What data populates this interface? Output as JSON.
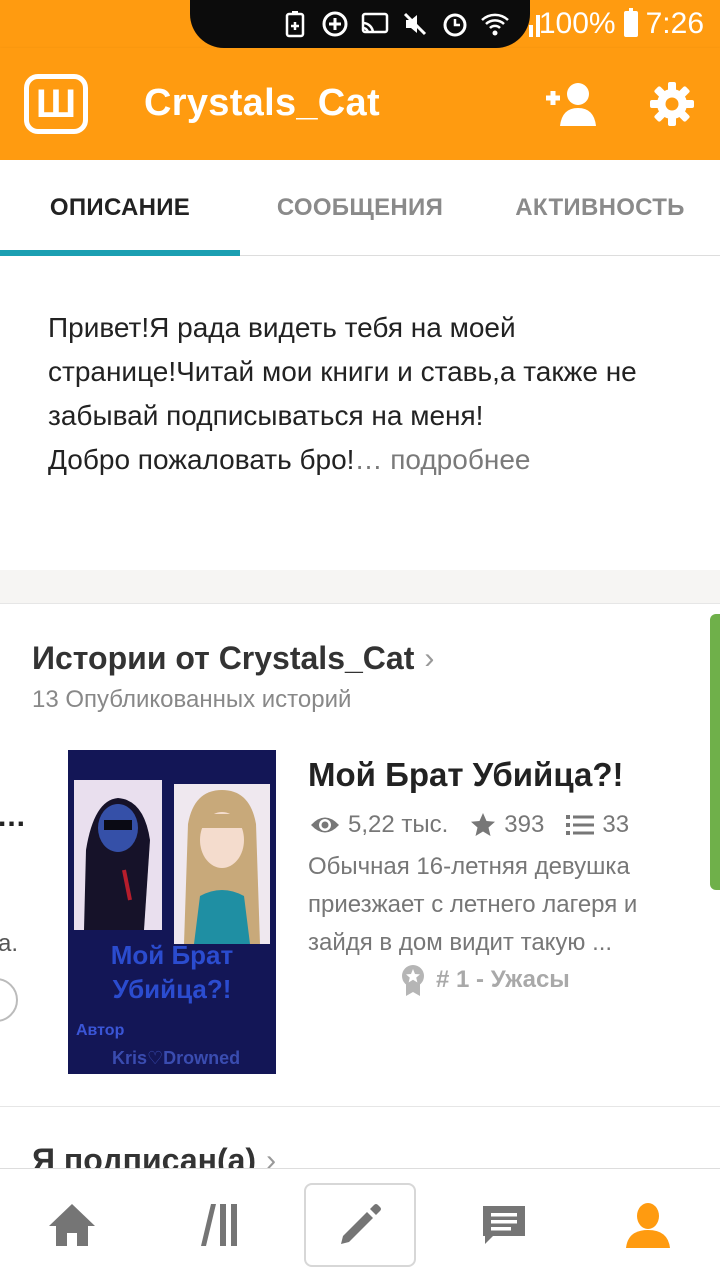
{
  "status_bar": {
    "battery": "100%",
    "time": "7:26",
    "icons": [
      "battery-saver-icon",
      "data-saver-icon",
      "cast-icon",
      "mute-icon",
      "alarm-icon",
      "wifi-icon",
      "signal-icon",
      "battery-icon"
    ]
  },
  "app_bar": {
    "logo": "Ш",
    "title": "Crystals_Cat",
    "actions": [
      "add-follower-icon",
      "settings-icon"
    ],
    "color": "#ff9b10"
  },
  "tabs": [
    {
      "label": "ОПИСАНИЕ",
      "active": true
    },
    {
      "label": "СООБЩЕНИЯ",
      "active": false
    },
    {
      "label": "АКТИВНОСТЬ",
      "active": false
    }
  ],
  "accent_color": "#1b9fb2",
  "description": {
    "text": "Привет!Я рада видеть тебя на моей странице!Читай мои книги и ставь,а также не забывай подписываться на меня!",
    "text2": "Добро пожаловать бро!",
    "ellipsis": "…",
    "more": " подробнее"
  },
  "stories": {
    "title": "Истории от Crystals_Cat",
    "count_label": "13 Опубликованных историй",
    "prev_peek_dots": "...",
    "prev_peek_letter": "а.",
    "story": {
      "title": "Мой Брат Убийца?!",
      "views": "5,22 тыс.",
      "votes": "393",
      "parts": "33",
      "description": "Обычная 16-летняя девушка приезжает с летнего лагеря и зайдя в дом видит такую ...",
      "rank": "# 1 - Ужасы",
      "cover": {
        "title_line1": "Мой Брат",
        "title_line2": "Убийца?!",
        "author_label": "Автор",
        "author_name": "Kris♡Drowned"
      }
    }
  },
  "following": {
    "title": "Я подписан(а)"
  },
  "bottom_nav": {
    "items": [
      "home-icon",
      "library-icon",
      "write-icon",
      "messages-icon",
      "profile-icon"
    ],
    "active": "profile-icon"
  }
}
